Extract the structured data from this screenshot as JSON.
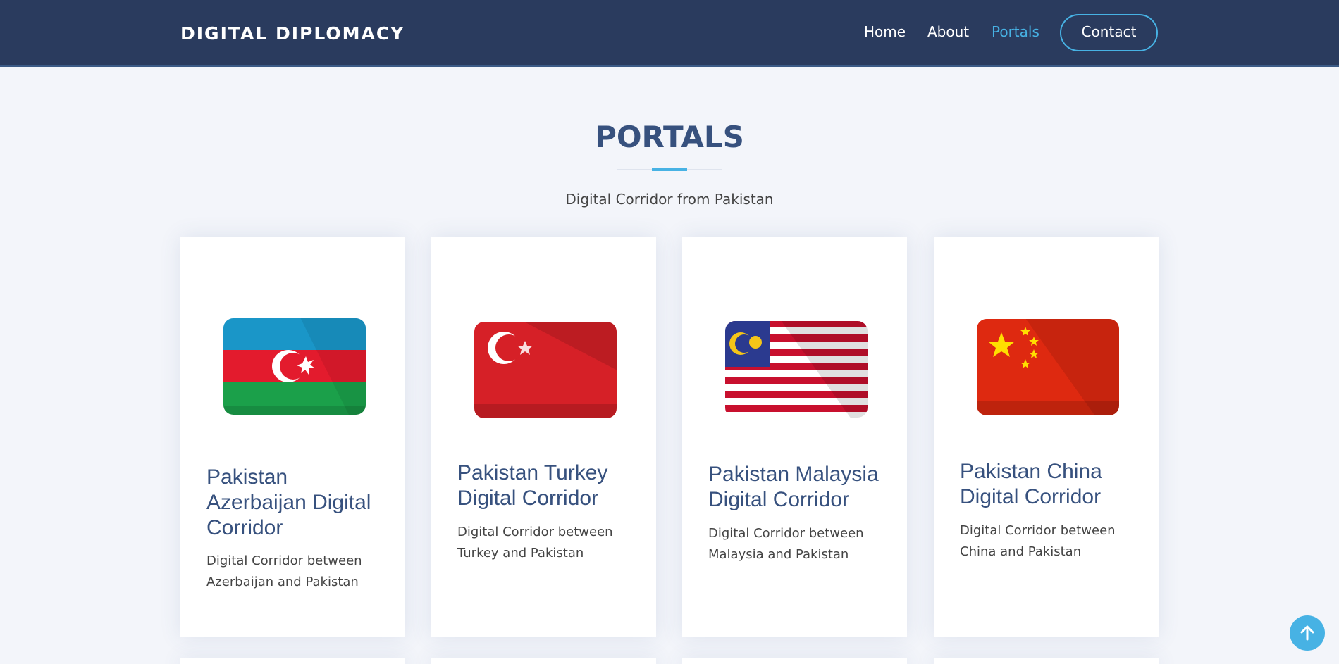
{
  "header": {
    "brand": "DIGITAL DIPLOMACY",
    "nav": [
      {
        "label": "Home"
      },
      {
        "label": "About"
      },
      {
        "label": "Portals"
      }
    ],
    "contact_label": "Contact"
  },
  "section": {
    "title": "PORTALS",
    "subtitle": "Digital Corridor from Pakistan"
  },
  "portals": [
    {
      "flag": "azerbaijan-flag",
      "title": "Pakistan Azerbaijan Digital Corridor",
      "desc": "Digital Corridor between Azerbaijan and Pakistan"
    },
    {
      "flag": "turkey-flag",
      "title": "Pakistan Turkey Digital Corridor",
      "desc": "Digital Corridor between Turkey and Pakistan"
    },
    {
      "flag": "malaysia-flag",
      "title": "Pakistan Malaysia Digital Corridor",
      "desc": "Digital Corridor between Malaysia and Pakistan"
    },
    {
      "flag": "china-flag",
      "title": "Pakistan China Digital Corridor",
      "desc": "Digital Corridor between China and Pakistan"
    }
  ],
  "icons": {
    "back_to_top": "arrow-up-icon"
  },
  "colors": {
    "header_bg": "#2a3b5e",
    "accent": "#47b2e4",
    "heading": "#37517e",
    "page_bg": "#f3f5fa"
  }
}
